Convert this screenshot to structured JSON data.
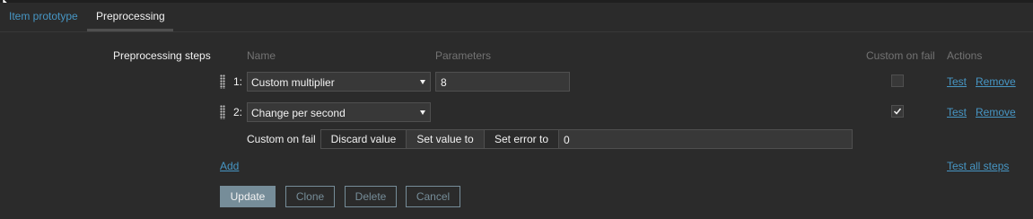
{
  "tabs": [
    {
      "label": "Item prototype"
    },
    {
      "label": "Preprocessing"
    }
  ],
  "form": {
    "section_label": "Preprocessing steps",
    "headers": {
      "name": "Name",
      "parameters": "Parameters",
      "custom_on_fail": "Custom on fail",
      "actions": "Actions"
    },
    "steps": [
      {
        "index": "1:",
        "name": "Custom multiplier",
        "parameter": "8",
        "custom_on_fail": false,
        "test": "Test",
        "remove": "Remove"
      },
      {
        "index": "2:",
        "name": "Change per second",
        "parameter": "",
        "custom_on_fail": true,
        "test": "Test",
        "remove": "Remove"
      }
    ],
    "custom_on_fail_row": {
      "label": "Custom on fail",
      "options": [
        "Discard value",
        "Set value to",
        "Set error to"
      ],
      "selected": "Set value to",
      "value": "0"
    },
    "add_link": "Add",
    "test_all_link": "Test all steps"
  },
  "buttons": {
    "update": "Update",
    "clone": "Clone",
    "delete": "Delete",
    "cancel": "Cancel"
  },
  "colors": {
    "background": "#2b2b2b",
    "link": "#4796c4",
    "primary_button": "#768d99",
    "header_text": "#737373"
  }
}
